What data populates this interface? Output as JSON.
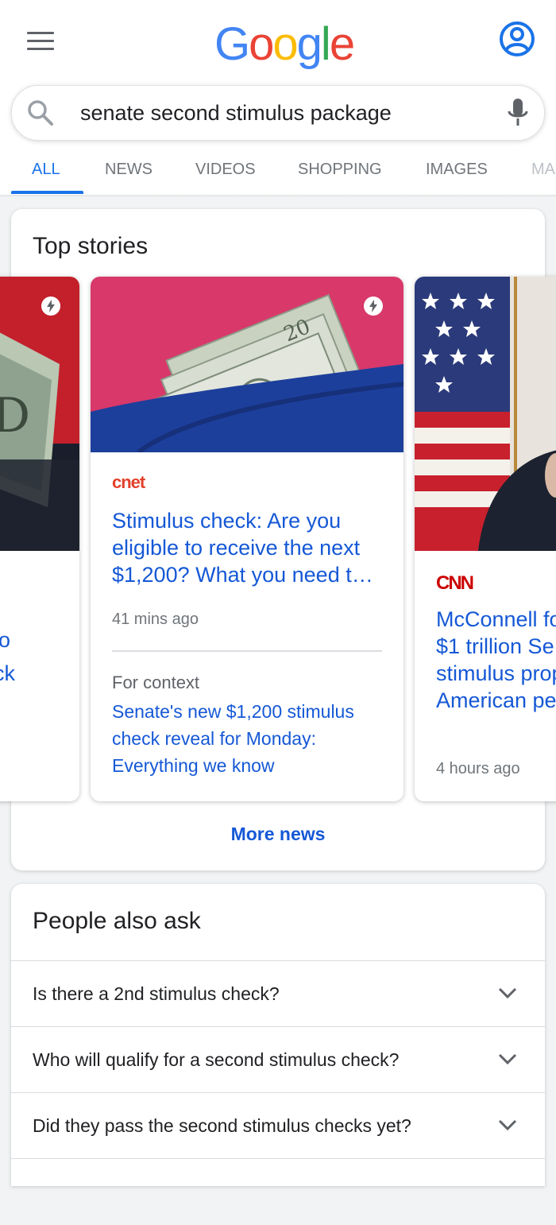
{
  "header": {
    "logo_letters": [
      {
        "char": "G",
        "color": "#4285F4"
      },
      {
        "char": "o",
        "color": "#EA4335"
      },
      {
        "char": "o",
        "color": "#FBBC05"
      },
      {
        "char": "g",
        "color": "#4285F4"
      },
      {
        "char": "l",
        "color": "#34A853"
      },
      {
        "char": "e",
        "color": "#EA4335"
      }
    ],
    "menu_icon": "hamburger-icon",
    "account_icon": "account-circle-icon"
  },
  "search": {
    "query": "senate second stimulus package",
    "search_icon": "search-icon",
    "mic_icon": "mic-icon"
  },
  "tabs": [
    {
      "label": "ALL",
      "active": true
    },
    {
      "label": "NEWS",
      "active": false
    },
    {
      "label": "VIDEOS",
      "active": false
    },
    {
      "label": "SHOPPING",
      "active": false
    },
    {
      "label": "IMAGES",
      "active": false
    },
    {
      "label": "MA",
      "active": false
    }
  ],
  "top_stories": {
    "title": "Top stories",
    "left_story": {
      "headline_fragments": [
        "o",
        "ck"
      ]
    },
    "main_story": {
      "source": "cnet",
      "headline": "Stimulus check: Are you eligible to receive the next $1,200? What you need t…",
      "time": "41 mins ago",
      "context_label": "For context",
      "context_link": "Senate's new $1,200 stimulus check reveal for Monday: Everything we know"
    },
    "right_story": {
      "source": "CNN",
      "headline": "McConnell fo $1 trillion Se stimulus prop American pe",
      "time": "4 hours ago"
    },
    "more_news": "More news"
  },
  "people_also_ask": {
    "title": "People also ask",
    "questions": [
      "Is there a 2nd stimulus check?",
      "Who will qualify for a second stimulus check?",
      "Did they pass the second stimulus checks yet?"
    ]
  },
  "colors": {
    "link": "#1558d6",
    "accent": "#1a73e8",
    "cnet_red": "#e2402b",
    "cnn_red": "#cc0000"
  }
}
